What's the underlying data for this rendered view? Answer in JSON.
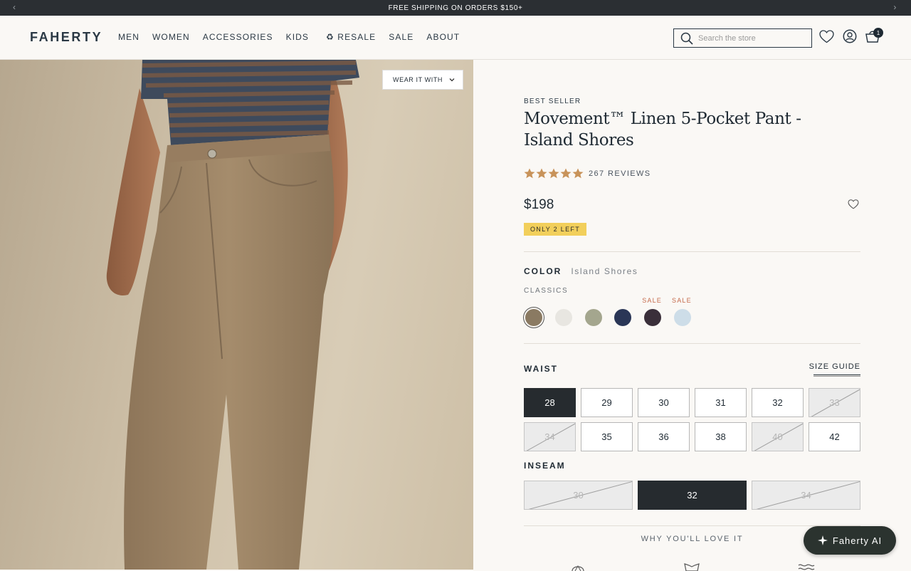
{
  "announcement": {
    "text": "FREE SHIPPING ON ORDERS $150+",
    "prev_arrow": "‹",
    "next_arrow": "›"
  },
  "header": {
    "logo": "FAHERTY",
    "nav": [
      "MEN",
      "WOMEN",
      "ACCESSORIES",
      "KIDS",
      "♻ RESALE",
      "SALE",
      "ABOUT"
    ],
    "search_placeholder": "Search the store",
    "cart_count": "1",
    "icons": [
      "search-icon",
      "heart-icon",
      "account-icon",
      "cart-icon"
    ]
  },
  "gallery": {
    "wear_it_with": "WEAR IT WITH"
  },
  "product": {
    "eyebrow": "BEST SELLER",
    "title": "Movement™ Linen 5-Pocket Pant - Island Shores",
    "rating": 5,
    "reviews": "267 REVIEWS",
    "price": "$198",
    "stock": "ONLY 2 LEFT",
    "color_label": "COLOR",
    "color_name": "Island Shores",
    "color_group": "CLASSICS",
    "swatches": [
      {
        "color": "#8a7a62",
        "selected": true,
        "sale": ""
      },
      {
        "color": "#e8e6e1",
        "selected": false,
        "sale": ""
      },
      {
        "color": "#a4a68e",
        "selected": false,
        "sale": ""
      },
      {
        "color": "#2a3656",
        "selected": false,
        "sale": ""
      },
      {
        "color": "#3a2f3a",
        "selected": false,
        "sale": "SALE"
      },
      {
        "color": "#cddde8",
        "selected": false,
        "sale": "SALE"
      }
    ],
    "waist_label": "WAIST",
    "size_guide": "SIZE GUIDE",
    "waist_sizes": [
      {
        "label": "28",
        "state": "selected"
      },
      {
        "label": "29",
        "state": "available"
      },
      {
        "label": "30",
        "state": "available"
      },
      {
        "label": "31",
        "state": "available"
      },
      {
        "label": "32",
        "state": "available"
      },
      {
        "label": "33",
        "state": "disabled"
      },
      {
        "label": "34",
        "state": "disabled"
      },
      {
        "label": "35",
        "state": "available"
      },
      {
        "label": "36",
        "state": "available"
      },
      {
        "label": "38",
        "state": "available"
      },
      {
        "label": "40",
        "state": "disabled"
      },
      {
        "label": "42",
        "state": "available"
      }
    ],
    "inseam_label": "INSEAM",
    "inseam_sizes": [
      {
        "label": "30",
        "state": "disabled"
      },
      {
        "label": "32",
        "state": "selected"
      },
      {
        "label": "34",
        "state": "disabled"
      }
    ],
    "why_heading": "WHY YOU'LL LOVE IT"
  },
  "assistant": {
    "label": "Faherty AI"
  },
  "colors": {
    "accent_dark": "#262b2f",
    "stock_badge": "#f2cf5b",
    "star": "#c8935a",
    "sale": "#c56a4b"
  }
}
